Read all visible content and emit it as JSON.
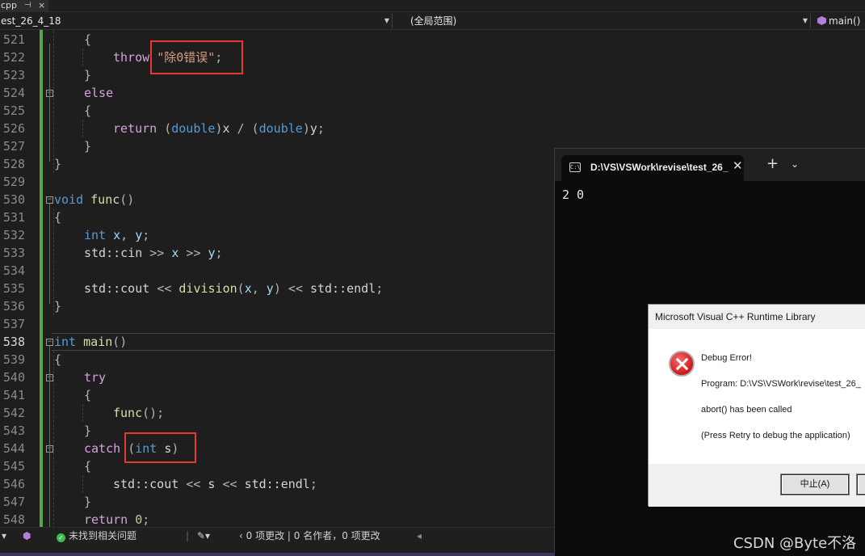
{
  "tab": {
    "file_label": "cpp",
    "pin": "⊣",
    "close": "×"
  },
  "navbar": {
    "project": "est_26_4_18",
    "scope": "(全局范围)",
    "function": "main()"
  },
  "editor": {
    "lines": [
      {
        "n": "521",
        "code": [
          [
            "pun",
            "{"
          ]
        ],
        "indent": 104
      },
      {
        "n": "522",
        "code": [
          [
            "kwc",
            "throw "
          ],
          [
            "str",
            "\"除0错误\""
          ],
          [
            "pun",
            ";"
          ]
        ],
        "indent": 140
      },
      {
        "n": "523",
        "code": [
          [
            "pun",
            "}"
          ]
        ],
        "indent": 104
      },
      {
        "n": "524",
        "code": [
          [
            "kwc",
            "else"
          ]
        ],
        "indent": 104
      },
      {
        "n": "525",
        "code": [
          [
            "pun",
            "{"
          ]
        ],
        "indent": 104
      },
      {
        "n": "526",
        "code": [
          [
            "kwc",
            "return "
          ],
          [
            "pun",
            "("
          ],
          [
            "kw",
            "double"
          ],
          [
            "pun",
            ")"
          ],
          [
            "cls",
            "x"
          ],
          [
            "pun",
            " / ("
          ],
          [
            "kw",
            "double"
          ],
          [
            "pun",
            ")"
          ],
          [
            "cls",
            "y"
          ],
          [
            "pun",
            ";"
          ]
        ],
        "indent": 140
      },
      {
        "n": "527",
        "code": [
          [
            "pun",
            "}"
          ]
        ],
        "indent": 104
      },
      {
        "n": "528",
        "code": [
          [
            "pun",
            "}"
          ]
        ],
        "indent": 67
      },
      {
        "n": "529",
        "code": [],
        "indent": 67
      },
      {
        "n": "530",
        "code": [
          [
            "kw",
            "void "
          ],
          [
            "fn",
            "func"
          ],
          [
            "pun",
            "()"
          ]
        ],
        "indent": 67
      },
      {
        "n": "531",
        "code": [
          [
            "pun",
            "{"
          ]
        ],
        "indent": 67
      },
      {
        "n": "532",
        "code": [
          [
            "kw",
            "int "
          ],
          [
            "var",
            "x"
          ],
          [
            "pun",
            ", "
          ],
          [
            "var",
            "y"
          ],
          [
            "pun",
            ";"
          ]
        ],
        "indent": 104
      },
      {
        "n": "533",
        "code": [
          [
            "cls",
            "std::cin "
          ],
          [
            "pun",
            ">> "
          ],
          [
            "var",
            "x"
          ],
          [
            "pun",
            " >> "
          ],
          [
            "var",
            "y"
          ],
          [
            "pun",
            ";"
          ]
        ],
        "indent": 104
      },
      {
        "n": "534",
        "code": [],
        "indent": 104
      },
      {
        "n": "535",
        "code": [
          [
            "cls",
            "std::cout "
          ],
          [
            "pun",
            "<< "
          ],
          [
            "fn",
            "division"
          ],
          [
            "pun",
            "("
          ],
          [
            "var",
            "x"
          ],
          [
            "pun",
            ", "
          ],
          [
            "var",
            "y"
          ],
          [
            "pun",
            ") << "
          ],
          [
            "cls",
            "std::endl"
          ],
          [
            "pun",
            ";"
          ]
        ],
        "indent": 104
      },
      {
        "n": "536",
        "code": [
          [
            "pun",
            "}"
          ]
        ],
        "indent": 67
      },
      {
        "n": "537",
        "code": [],
        "indent": 67
      },
      {
        "n": "538",
        "code": [
          [
            "kw",
            "int "
          ],
          [
            "fn",
            "main"
          ],
          [
            "pun",
            "()"
          ]
        ],
        "indent": 67
      },
      {
        "n": "539",
        "code": [
          [
            "pun",
            "{"
          ]
        ],
        "indent": 67
      },
      {
        "n": "540",
        "code": [
          [
            "kwc",
            "try"
          ]
        ],
        "indent": 104
      },
      {
        "n": "541",
        "code": [
          [
            "pun",
            "{"
          ]
        ],
        "indent": 104
      },
      {
        "n": "542",
        "code": [
          [
            "fn",
            "func"
          ],
          [
            "pun",
            "();"
          ]
        ],
        "indent": 140
      },
      {
        "n": "543",
        "code": [
          [
            "pun",
            "}"
          ]
        ],
        "indent": 104
      },
      {
        "n": "544",
        "code": [
          [
            "kwc",
            "catch "
          ],
          [
            "pun",
            "("
          ],
          [
            "kw",
            "int "
          ],
          [
            "cls",
            "s"
          ],
          [
            "pun",
            ")"
          ]
        ],
        "indent": 104
      },
      {
        "n": "545",
        "code": [
          [
            "pun",
            "{"
          ]
        ],
        "indent": 104
      },
      {
        "n": "546",
        "code": [
          [
            "cls",
            "std::cout "
          ],
          [
            "pun",
            "<< "
          ],
          [
            "cls",
            "s"
          ],
          [
            "pun",
            " << "
          ],
          [
            "cls",
            "std::endl"
          ],
          [
            "pun",
            ";"
          ]
        ],
        "indent": 140
      },
      {
        "n": "547",
        "code": [
          [
            "pun",
            "}"
          ]
        ],
        "indent": 104
      },
      {
        "n": "548",
        "code": [
          [
            "kwc",
            "return "
          ],
          [
            "num",
            "0"
          ],
          [
            "pun",
            ";"
          ]
        ],
        "indent": 104
      }
    ]
  },
  "statusbar": {
    "issues": "未找到相关问题",
    "changes": "0 项更改 | 0 名作者，0 项更改"
  },
  "terminal": {
    "title": "D:\\VS\\VSWork\\revise\\test_26_",
    "icon_text": "C:\\",
    "output": "2 0"
  },
  "dialog": {
    "title": "Microsoft Visual C++ Runtime Library",
    "heading": "Debug Error!",
    "program": "Program: D:\\VS\\VSWork\\revise\\test_26_",
    "message": "abort() has been called",
    "hint": "(Press Retry to debug the application)",
    "abort_button": "中止(A)"
  },
  "watermark": "CSDN @Byte不洛",
  "colors": {
    "error_box": "#e53935",
    "git_bar": "#57a64a"
  }
}
